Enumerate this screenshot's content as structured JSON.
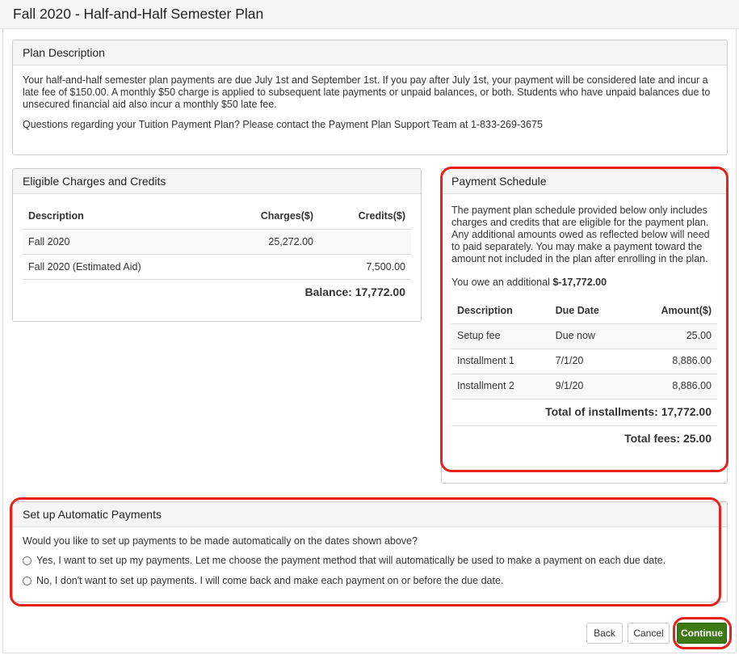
{
  "page": {
    "title": "Fall 2020 - Half-and-Half Semester Plan"
  },
  "plan_description": {
    "heading": "Plan Description",
    "paragraph1": "Your half-and-half semester plan payments are due July 1st and September 1st. If you pay after July 1st, your payment will be considered late and incur a late fee of $150.00. A monthly $50 charge is applied to subsequent late payments or unpaid balances, or both. Students who have unpaid balances due to unsecured financial aid also incur a monthly $50 late fee.",
    "paragraph2": "Questions regarding your Tuition Payment Plan?  Please contact the Payment Plan Support Team at 1-833-269-3675"
  },
  "charges": {
    "heading": "Eligible Charges and Credits",
    "columns": [
      "Description",
      "Charges($)",
      "Credits($)"
    ],
    "rows": [
      {
        "description": "Fall 2020",
        "charges": "25,272.00",
        "credits": ""
      },
      {
        "description": "Fall 2020 (Estimated Aid)",
        "charges": "",
        "credits": "7,500.00"
      }
    ],
    "balance": "Balance: 17,772.00"
  },
  "schedule": {
    "heading": "Payment Schedule",
    "intro": "The payment plan schedule provided below only includes charges and credits that are eligible for the payment plan. Any additional amounts owed as reflected below will need to paid separately. You may make a payment toward the amount not included in the plan after enrolling in the plan.",
    "owe_prefix": "You owe an additional ",
    "owe_amount": "$-17,772.00",
    "columns": [
      "Description",
      "Due Date",
      "Amount($)"
    ],
    "rows": [
      {
        "description": "Setup fee",
        "due": "Due now",
        "amount": "25.00"
      },
      {
        "description": "Installment 1",
        "due": "7/1/20",
        "amount": "8,886.00"
      },
      {
        "description": "Installment 2",
        "due": "9/1/20",
        "amount": "8,886.00"
      }
    ],
    "total_installments": "Total of installments: 17,772.00",
    "total_fees": "Total fees: 25.00"
  },
  "auto_payments": {
    "heading": "Set up Automatic Payments",
    "question": "Would you like to set up payments to be made automatically on the dates shown above?",
    "option_yes": "Yes, I want to set up my payments. Let me choose the payment method that will automatically be used to make a payment on each due date.",
    "option_no": "No, I don't want to set up payments. I will come back and make each payment on or before the due date."
  },
  "buttons": {
    "back": "Back",
    "cancel": "Cancel",
    "continue": "Continue"
  },
  "colors": {
    "highlight": "#e8211d",
    "continue_green": "#3d7a14"
  }
}
